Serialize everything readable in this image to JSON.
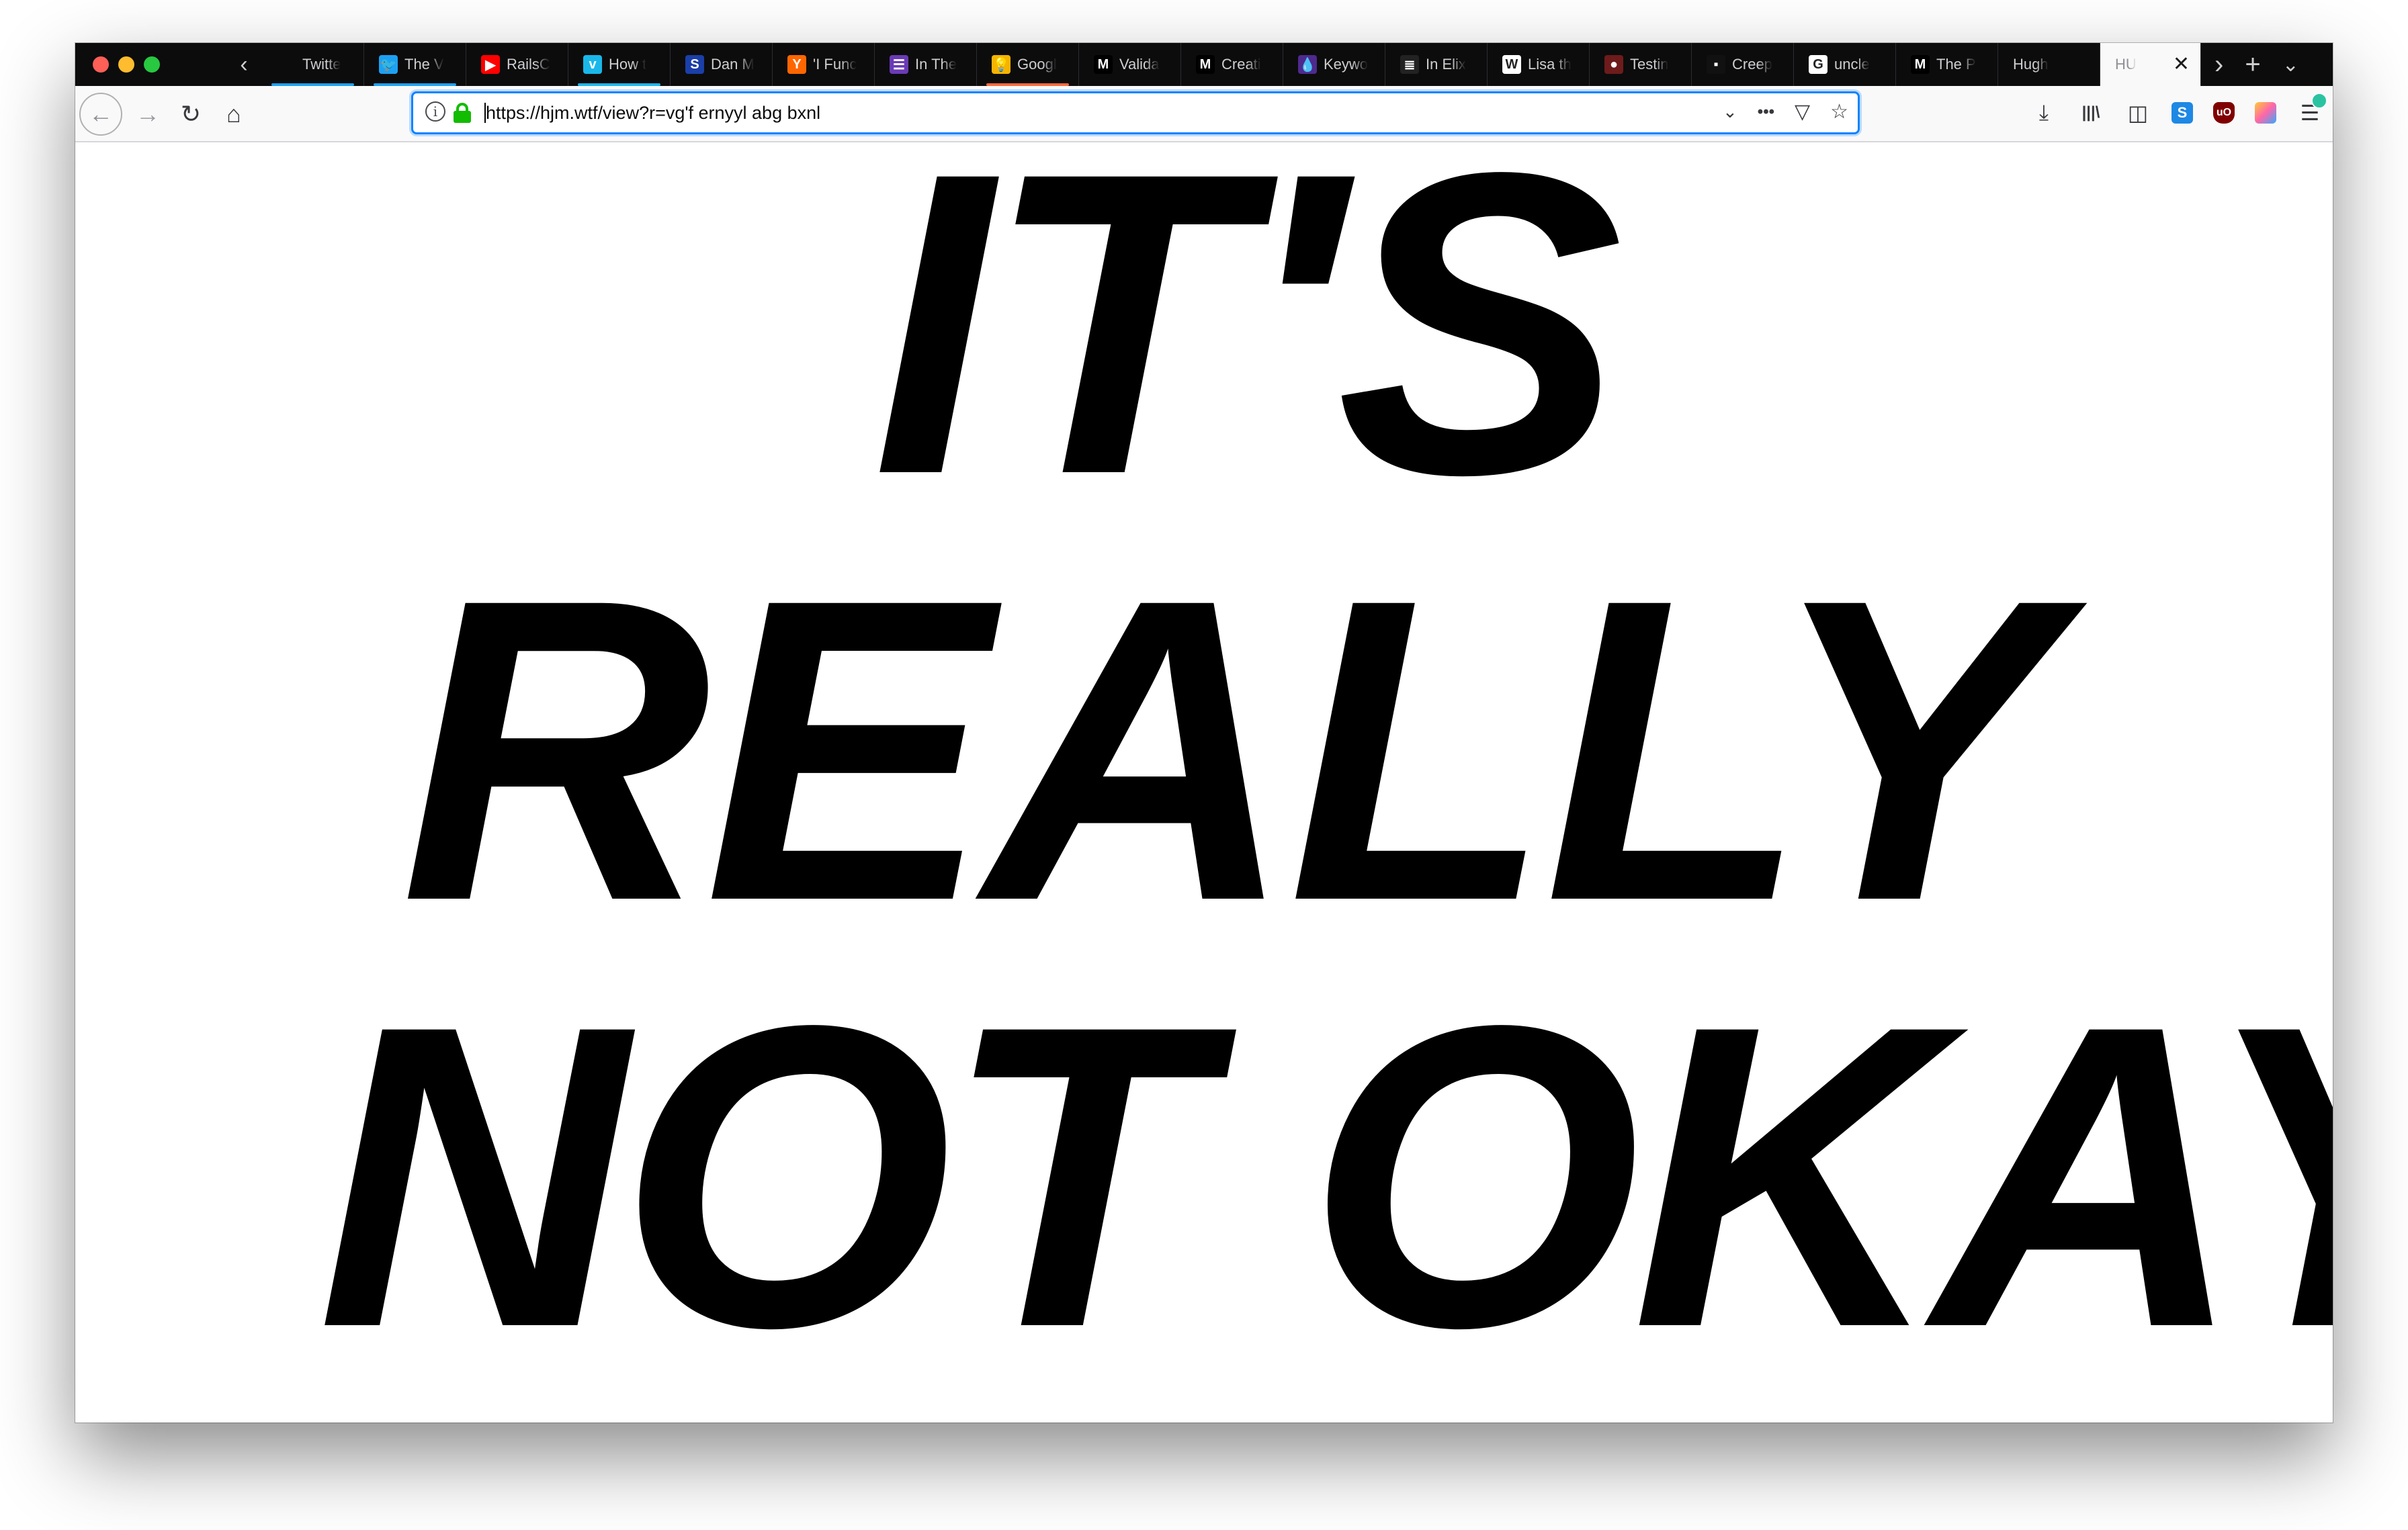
{
  "browser": {
    "tabs": [
      {
        "title": "Twitte",
        "icon": "twitter-icon",
        "fav_bg": "",
        "fav_glyph": "",
        "underline": "#1da1f2"
      },
      {
        "title": "The V",
        "icon": "twitter-bird-icon",
        "fav_bg": "#1da1f2",
        "fav_glyph": "🐦",
        "underline": "#1da1f2"
      },
      {
        "title": "RailsC",
        "icon": "youtube-icon",
        "fav_bg": "#ff0000",
        "fav_glyph": "▶",
        "underline": ""
      },
      {
        "title": "How t",
        "icon": "vimeo-icon",
        "fav_bg": "#1ab7ea",
        "fav_glyph": "v",
        "underline": "#1ab7ea"
      },
      {
        "title": "Dan M",
        "icon": "s-icon",
        "fav_bg": "#1a3fa8",
        "fav_glyph": "S",
        "underline": ""
      },
      {
        "title": "'I Func",
        "icon": "ycombinator-icon",
        "fav_bg": "#ff6600",
        "fav_glyph": "Y",
        "underline": ""
      },
      {
        "title": "In The",
        "icon": "list-icon",
        "fav_bg": "#6a3bb5",
        "fav_glyph": "☰",
        "underline": ""
      },
      {
        "title": "Googl",
        "icon": "google-keep-icon",
        "fav_bg": "#f6b400",
        "fav_glyph": "💡",
        "underline": "#ff6a3d"
      },
      {
        "title": "Valida",
        "icon": "medium-icon",
        "fav_bg": "#000000",
        "fav_glyph": "M",
        "underline": ""
      },
      {
        "title": "Creati",
        "icon": "medium-icon",
        "fav_bg": "#000000",
        "fav_glyph": "M",
        "underline": ""
      },
      {
        "title": "Keywo",
        "icon": "elixir-drop-icon",
        "fav_bg": "#4e2a8e",
        "fav_glyph": "💧",
        "underline": ""
      },
      {
        "title": "In Elix",
        "icon": "stackoverflow-icon",
        "fav_bg": "#222222",
        "fav_glyph": "≣",
        "underline": ""
      },
      {
        "title": "Lisa th",
        "icon": "wikipedia-icon",
        "fav_bg": "#ffffff",
        "fav_glyph": "W",
        "underline": ""
      },
      {
        "title": "Testin",
        "icon": "github-icon",
        "fav_bg": "#6e1b1b",
        "fav_glyph": "●",
        "underline": ""
      },
      {
        "title": "Creep",
        "icon": "dark-site-icon",
        "fav_bg": "#111111",
        "fav_glyph": "▪",
        "underline": ""
      },
      {
        "title": "uncle",
        "icon": "google-icon",
        "fav_bg": "#ffffff",
        "fav_glyph": "G",
        "underline": ""
      },
      {
        "title": "The P",
        "icon": "medium-icon",
        "fav_bg": "#000000",
        "fav_glyph": "M",
        "underline": ""
      },
      {
        "title": "Hugh",
        "icon": "",
        "fav_bg": "",
        "fav_glyph": "",
        "underline": ""
      }
    ],
    "active_tab": {
      "title": "HU",
      "close": "✕"
    },
    "tab_scroll_left": "‹",
    "tab_scroll_right": "›",
    "new_tab": "+",
    "tab_list": "⌄",
    "nav": {
      "back": "←",
      "forward": "→",
      "reload": "↻",
      "home": "⌂"
    },
    "url": "https://hjm.wtf/view?r=vg'f ernyyl abg bxnl",
    "url_actions": {
      "dropdown": "⌄",
      "page_actions": "•••",
      "pocket": "▽",
      "bookmark": "☆"
    },
    "toolbar": {
      "download": "⤓",
      "library": "|||\\",
      "sidebar": "◫",
      "menu": "☰"
    }
  },
  "page": {
    "line1": "IT'S",
    "line2": "REALLY",
    "line3": "NOT OKAY"
  }
}
